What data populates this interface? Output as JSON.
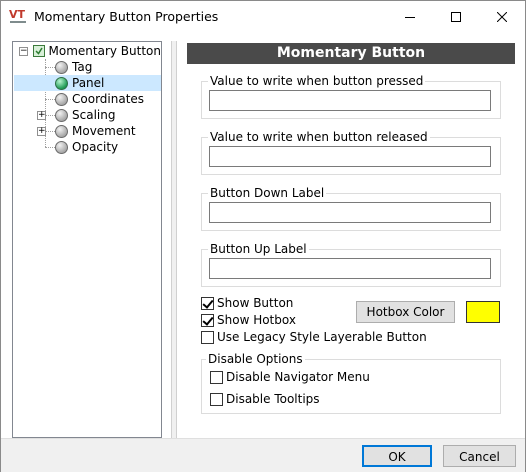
{
  "window": {
    "app_icon_text": "VT",
    "title": "Momentary Button Properties",
    "minimize_icon": "minimize-icon",
    "maximize_icon": "maximize-icon",
    "close_icon": "close-icon"
  },
  "tree": {
    "root": {
      "label": "Momentary Button",
      "expander": "−"
    },
    "items": [
      {
        "label": "Tag",
        "expander": ""
      },
      {
        "label": "Panel",
        "expander": "",
        "selected": true
      },
      {
        "label": "Coordinates",
        "expander": ""
      },
      {
        "label": "Scaling",
        "expander": "+"
      },
      {
        "label": "Movement",
        "expander": "+"
      },
      {
        "label": "Opacity",
        "expander": ""
      }
    ]
  },
  "panel": {
    "header": "Momentary Button",
    "pressed": {
      "label": "Value to write when button pressed",
      "value": ""
    },
    "released": {
      "label": "Value to write when button released",
      "value": ""
    },
    "down_label": {
      "label": "Button Down Label",
      "value": ""
    },
    "up_label": {
      "label": "Button Up Label",
      "value": ""
    },
    "show_button": {
      "label": "Show Button",
      "checked": true
    },
    "show_hotbox": {
      "label": "Show Hotbox",
      "checked": true
    },
    "legacy_style": {
      "label": "Use Legacy Style Layerable Button",
      "checked": false
    },
    "hotbox_color_button": "Hotbox Color",
    "hotbox_color": "#ffff00",
    "disable_options": {
      "label": "Disable Options",
      "navigator_menu": {
        "label": "Disable Navigator Menu",
        "checked": false
      },
      "tooltips": {
        "label": "Disable Tooltips",
        "checked": false
      }
    }
  },
  "footer": {
    "ok": "OK",
    "cancel": "Cancel"
  },
  "colors": {
    "header_bg": "#4a4a4a",
    "selection": "#cce8ff",
    "accent": "#0078d7",
    "app_icon": "#c0392b"
  }
}
